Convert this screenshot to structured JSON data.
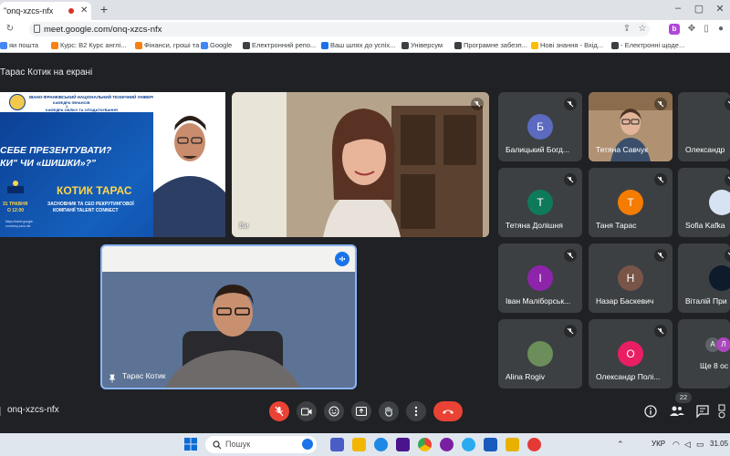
{
  "browser": {
    "tab_title": "\"onq-xzcs-nfx",
    "url": "meet.google.com/onq-xzcs-nfx",
    "new_tab": "+",
    "window_controls": [
      "–",
      "▢",
      "✕"
    ],
    "toolbar_icons": [
      "share-icon",
      "star-icon",
      "extension-icon",
      "sidebar-icon",
      "profile-icon",
      "menu-icon"
    ],
    "extension_badge": "b",
    "bookmarks": [
      {
        "label": "яи пошта",
        "icon": "mail-icon",
        "color": "#4285f4"
      },
      {
        "label": "Курс: B2 Курс англі...",
        "icon": "moodle-icon",
        "color": "#f98012"
      },
      {
        "label": "Фінанси, гроші та к...",
        "icon": "moodle-icon",
        "color": "#f98012"
      },
      {
        "label": "Google",
        "icon": "google-icon",
        "color": "#4285f4"
      },
      {
        "label": "Електронний репо...",
        "icon": "repo-icon",
        "color": "#3c4043"
      },
      {
        "label": "Ваш шлях до успіх...",
        "icon": "globe-icon",
        "color": "#1a73e8"
      },
      {
        "label": "Універсум",
        "icon": "grid-icon",
        "color": "#3c4043"
      },
      {
        "label": "Програмне забезп...",
        "icon": "doc-icon",
        "color": "#3c4043"
      },
      {
        "label": "Нові знання - Вхід...",
        "icon": "bulb-icon",
        "color": "#fbbc04"
      },
      {
        "label": "- Електронні щоде...",
        "icon": "book-icon",
        "color": "#3c4043"
      }
    ]
  },
  "meet": {
    "presenting_label": "Тарас Котик на екрані",
    "meeting_code": "onq-xzcs-nfx",
    "people_count": "22",
    "slide": {
      "university": "ІВАНО-ФРАНКІВСЬКИЙ НАЦІОНАЛЬНИЙ ТЕХНІЧНИЙ УНІВЕРСИТЕТ НАФТИ І ГАЗУ",
      "dept1": "КАФЕДРА ФІНАНСІВ",
      "amp": "&",
      "dept2": "КАФЕДРА ОБЛІКУ ТА ОПОДАТКУВАННЯ",
      "q1": "СЕБЕ ПРЕЗЕНТУВАТИ?",
      "q2": "КИ\" ЧИ «ШИШКИ»?\"",
      "name": "КОТИК ТАРАС",
      "role1": "ЗАСНОВНИК ТА CEO РЕКРУТИНГОВОЇ",
      "role2": "КОМПАНІЇ TALENT CONNECT",
      "date1": "31 ТРАВНЯ",
      "date2": "О 12:00",
      "link1": "https://meet.google.",
      "link2": "com/onq-xzcs-nfx"
    },
    "self_tile_label": "Ви",
    "presenter_name": "Тарас Котик",
    "participants": [
      {
        "name": "Балицький Богд...",
        "letter": "Б",
        "color": "#5c6bc0"
      },
      {
        "name": "Тетяна Савчук",
        "letter": "",
        "color": "#000000"
      },
      {
        "name": "Олександр",
        "letter": "",
        "color": "#5f6368"
      },
      {
        "name": "Тетяна Долішня",
        "letter": "Т",
        "color": "#0f7a5a"
      },
      {
        "name": "Таня Тарас",
        "letter": "Т",
        "color": "#f57c00"
      },
      {
        "name": "Sofia Kafka",
        "letter": "",
        "color": "#000000"
      },
      {
        "name": "Іван Маліборськ...",
        "letter": "І",
        "color": "#8e24aa"
      },
      {
        "name": "Назар Баскевич",
        "letter": "Н",
        "color": "#795548"
      },
      {
        "name": "Віталій При",
        "letter": "",
        "color": "#000000"
      },
      {
        "name": "Alina Rogiv",
        "letter": "",
        "color": "#000000"
      },
      {
        "name": "Олександр Полі...",
        "letter": "О",
        "color": "#e91e63"
      },
      {
        "name": "Ще 8 ос",
        "letter": "",
        "color": "#000000"
      }
    ],
    "more_avatars": [
      "А",
      "Л"
    ]
  },
  "taskbar": {
    "search_label": "Пошук",
    "lang": "УКР",
    "date": "31.05"
  },
  "colors": {
    "meet_bg": "#202124",
    "tile_bg": "#3c4043",
    "end_call": "#ea4335",
    "mic_off": "#ea4335",
    "speaking_border": "#8ab4f8"
  }
}
